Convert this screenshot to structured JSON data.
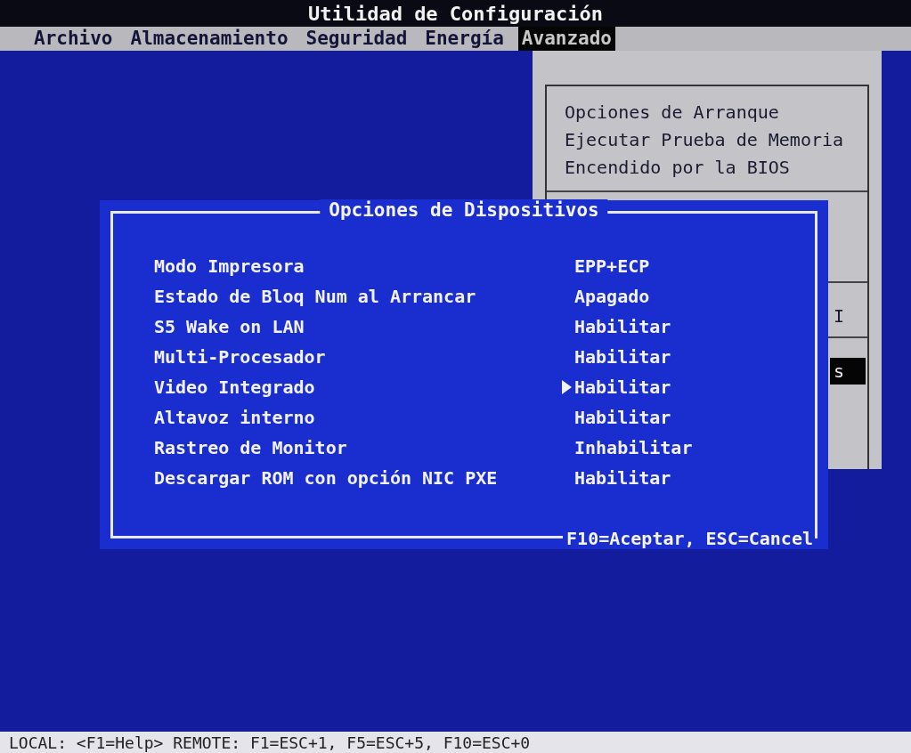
{
  "window": {
    "title": "Utilidad de Configuración"
  },
  "menu_bar": [
    {
      "label": "Archivo",
      "selected": false
    },
    {
      "label": "Almacenamiento",
      "selected": false
    },
    {
      "label": "Seguridad",
      "selected": false
    },
    {
      "label": "Energía",
      "selected": false
    },
    {
      "label": "Avanzado",
      "selected": true
    }
  ],
  "dropdown": {
    "items": [
      {
        "label": "Opciones de Arranque",
        "selected": false
      },
      {
        "label": "Ejecutar Prueba de Memoria",
        "selected": false
      },
      {
        "label": "Encendido por la BIOS",
        "selected": false
      }
    ],
    "partial_items": [
      {
        "label": "I",
        "selected": false
      },
      {
        "label": "s",
        "selected": true
      }
    ]
  },
  "dialog": {
    "title": "Opciones de Dispositivos",
    "rows": [
      {
        "label": "Modo Impresora",
        "value": "EPP+ECP",
        "selected": false
      },
      {
        "label": "Estado de Bloq Num al Arrancar",
        "value": "Apagado",
        "selected": false
      },
      {
        "label": "S5 Wake on LAN",
        "value": "Habilitar",
        "selected": false
      },
      {
        "label": "Multi-Procesador",
        "value": "Habilitar",
        "selected": false
      },
      {
        "label": "Video Integrado",
        "value": "Habilitar",
        "selected": true
      },
      {
        "label": "Altavoz interno",
        "value": "Habilitar",
        "selected": false
      },
      {
        "label": "Rastreo de Monitor",
        "value": "Inhabilitar",
        "selected": false
      },
      {
        "label": "Descargar ROM con opción NIC PXE",
        "value": "Habilitar",
        "selected": false
      }
    ],
    "footer": "F10=Aceptar, ESC=Cancel"
  },
  "status_bar": "LOCAL: <F1=Help> REMOTE: F1=ESC+1, F5=ESC+5, F10=ESC+0"
}
